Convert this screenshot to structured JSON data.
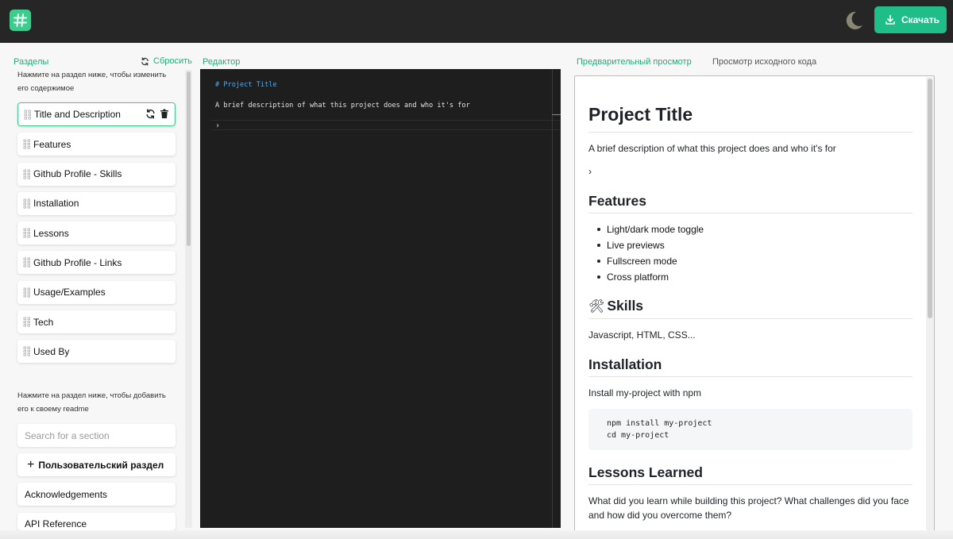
{
  "header": {
    "logo_icon": "hash-icon",
    "theme_icon": "moon-icon",
    "download_label": "Скачать",
    "accent": "#1fbd88"
  },
  "sections_panel": {
    "title": "Разделы",
    "reset_label": "Сбросить",
    "edit_hint": "Нажмите на раздел ниже, чтобы изменить его содержимое",
    "items": [
      {
        "label": "Title and Description",
        "active": true
      },
      {
        "label": "Features"
      },
      {
        "label": "Github Profile - Skills"
      },
      {
        "label": "Installation"
      },
      {
        "label": "Lessons"
      },
      {
        "label": "Github Profile - Links"
      },
      {
        "label": "Usage/Examples"
      },
      {
        "label": "Tech"
      },
      {
        "label": "Used By"
      }
    ],
    "add_hint": "Нажмите на раздел ниже, чтобы добавить его к своему readme",
    "search_placeholder": "Search for a section",
    "custom_section_label": "Пользовательский раздел",
    "available": [
      "Acknowledgements",
      "API Reference"
    ]
  },
  "editor": {
    "title": "Редактор",
    "lines": [
      "# Project Title",
      "A brief description of what this project does and who it's for",
      "›"
    ]
  },
  "preview": {
    "tab_preview": "Предварительный просмотр",
    "tab_source": "Просмотр исходного кода",
    "h1": "Project Title",
    "intro": "A brief description of what this project does and who it's for",
    "chevron": "›",
    "features_heading": "Features",
    "features": [
      "Light/dark mode toggle",
      "Live previews",
      "Fullscreen mode",
      "Cross platform"
    ],
    "skills_heading": "Skills",
    "skills_emoji": "🛠",
    "skills_text": "Javascript, HTML, CSS...",
    "install_heading": "Installation",
    "install_text": "Install my-project with npm",
    "install_code": "npm install my-project\ncd my-project",
    "lessons_heading": "Lessons Learned",
    "lessons_text": "What did you learn while building this project? What challenges did you face and how did you overcome them?"
  }
}
